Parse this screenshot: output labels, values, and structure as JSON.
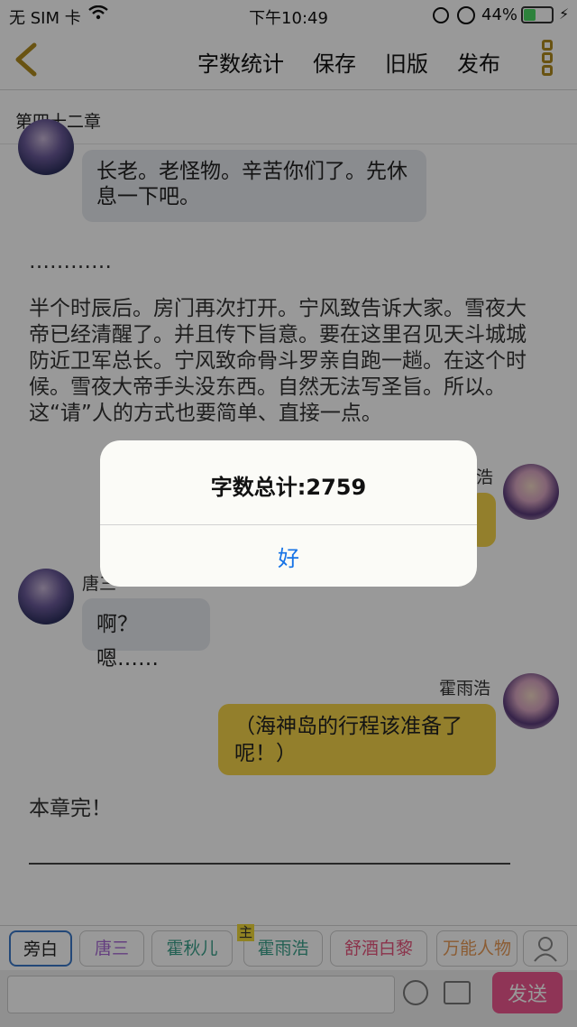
{
  "status_bar": {
    "carrier": "无 SIM 卡",
    "time": "下午10:49",
    "battery_percent": "44%",
    "battery_level": 0.44
  },
  "nav": {
    "word_count": "字数统计",
    "save": "保存",
    "old_version": "旧版",
    "publish": "发布"
  },
  "chapter_title": "第四十二章",
  "content": {
    "msg1": "长老。老怪物。辛苦你们了。先休息一下吧。",
    "ellipsis": "…………",
    "paragraph": "半个时辰后。房门再次打开。宁风致告诉大家。雪夜大帝已经清醒了。并且传下旨意。要在这里召见天斗城城防近卫军总长。宁风致命骨斗罗亲自跑一趟。在这个时候。雪夜大帝手头没东西。自然无法写圣旨。所以。这“请”人的方式也要简单、直接一点。",
    "name_huo_partial": "浩",
    "name_tang_partial": "唐三",
    "msg_tang": "啊？嗯……",
    "name_huo": "霍雨浩",
    "msg_huo": "（海神岛的行程该准备了呢！）",
    "chapter_end": "本章完！"
  },
  "chips": [
    {
      "label": "旁白",
      "color": "#222222"
    },
    {
      "label": "唐三",
      "color": "#a86ad6"
    },
    {
      "label": "霍秋儿",
      "color": "#3aa18a"
    },
    {
      "label": "霍雨浩",
      "color": "#3aa18a",
      "badge": "主"
    },
    {
      "label": "舒酒白黎",
      "color": "#e8557d"
    },
    {
      "label": "万能人物",
      "color": "#e89a55"
    }
  ],
  "composer": {
    "placeholder": "",
    "send": "发送"
  },
  "alert": {
    "message": "字数总计:2759",
    "ok": "好"
  }
}
